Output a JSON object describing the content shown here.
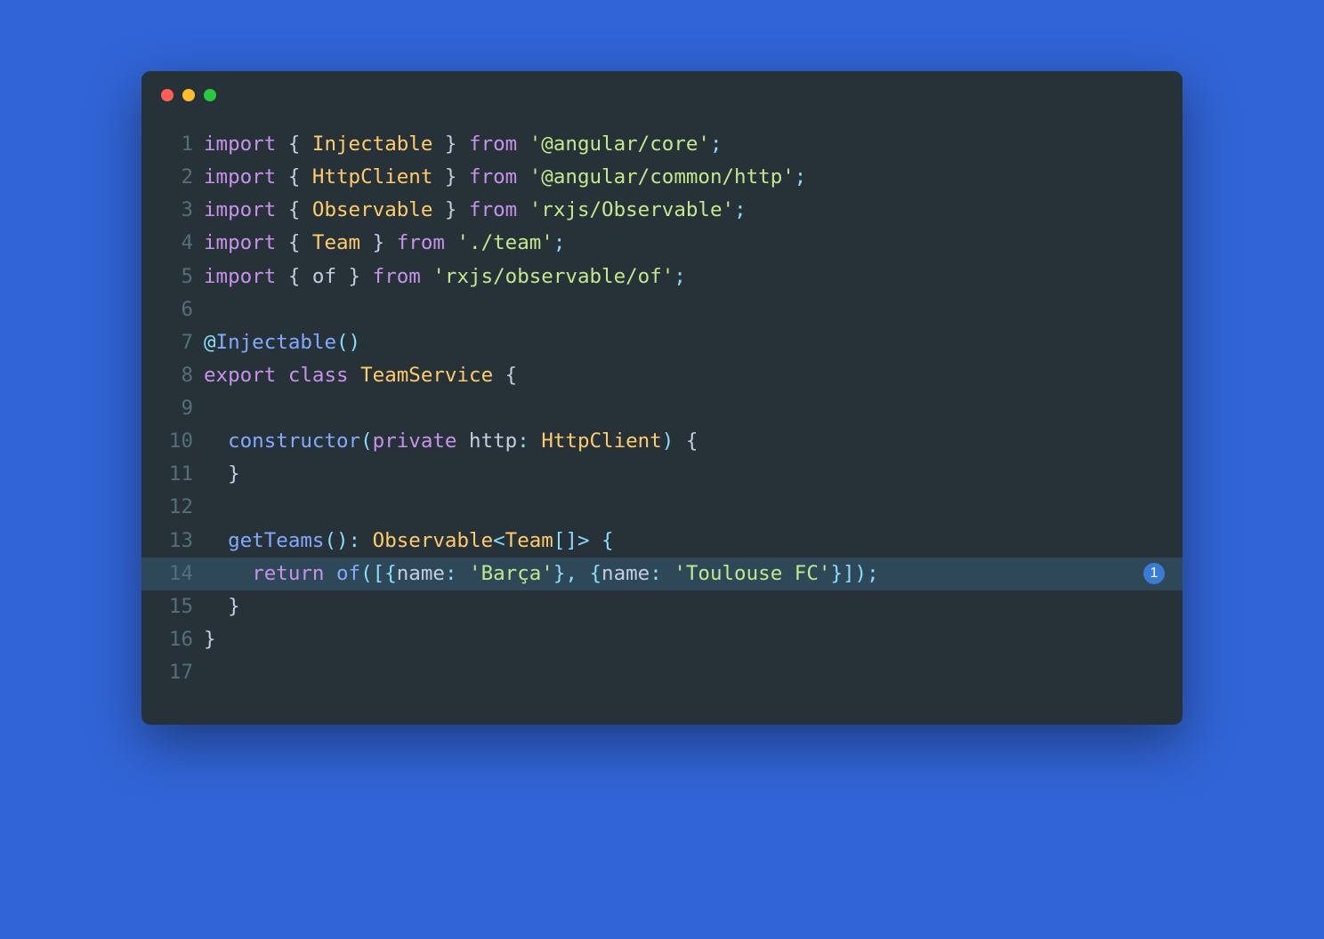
{
  "window": {
    "dots": [
      "red",
      "yellow",
      "green"
    ]
  },
  "code": {
    "highlighted_line": 14,
    "badge_line": 14,
    "badge_text": "1",
    "lines": [
      {
        "num": 1,
        "tokens": [
          {
            "t": "import",
            "c": "keyword"
          },
          {
            "t": " { ",
            "c": "plain"
          },
          {
            "t": "Injectable",
            "c": "type"
          },
          {
            "t": " } ",
            "c": "plain"
          },
          {
            "t": "from",
            "c": "keyword"
          },
          {
            "t": " ",
            "c": "plain"
          },
          {
            "t": "'@angular/core'",
            "c": "string"
          },
          {
            "t": ";",
            "c": "punct"
          }
        ]
      },
      {
        "num": 2,
        "tokens": [
          {
            "t": "import",
            "c": "keyword"
          },
          {
            "t": " { ",
            "c": "plain"
          },
          {
            "t": "HttpClient",
            "c": "type"
          },
          {
            "t": " } ",
            "c": "plain"
          },
          {
            "t": "from",
            "c": "keyword"
          },
          {
            "t": " ",
            "c": "plain"
          },
          {
            "t": "'@angular/common/http'",
            "c": "string"
          },
          {
            "t": ";",
            "c": "punct"
          }
        ]
      },
      {
        "num": 3,
        "tokens": [
          {
            "t": "import",
            "c": "keyword"
          },
          {
            "t": " { ",
            "c": "plain"
          },
          {
            "t": "Observable",
            "c": "type"
          },
          {
            "t": " } ",
            "c": "plain"
          },
          {
            "t": "from",
            "c": "keyword"
          },
          {
            "t": " ",
            "c": "plain"
          },
          {
            "t": "'rxjs/Observable'",
            "c": "string"
          },
          {
            "t": ";",
            "c": "punct"
          }
        ]
      },
      {
        "num": 4,
        "tokens": [
          {
            "t": "import",
            "c": "keyword"
          },
          {
            "t": " { ",
            "c": "plain"
          },
          {
            "t": "Team",
            "c": "type"
          },
          {
            "t": " } ",
            "c": "plain"
          },
          {
            "t": "from",
            "c": "keyword"
          },
          {
            "t": " ",
            "c": "plain"
          },
          {
            "t": "'./team'",
            "c": "string"
          },
          {
            "t": ";",
            "c": "punct"
          }
        ]
      },
      {
        "num": 5,
        "tokens": [
          {
            "t": "import",
            "c": "keyword"
          },
          {
            "t": " { ",
            "c": "plain"
          },
          {
            "t": "of",
            "c": "plain"
          },
          {
            "t": " } ",
            "c": "plain"
          },
          {
            "t": "from",
            "c": "keyword"
          },
          {
            "t": " ",
            "c": "plain"
          },
          {
            "t": "'rxjs/observable/of'",
            "c": "string"
          },
          {
            "t": ";",
            "c": "punct"
          }
        ]
      },
      {
        "num": 6,
        "tokens": []
      },
      {
        "num": 7,
        "tokens": [
          {
            "t": "@",
            "c": "punct"
          },
          {
            "t": "Injectable",
            "c": "deco"
          },
          {
            "t": "()",
            "c": "punct"
          }
        ]
      },
      {
        "num": 8,
        "tokens": [
          {
            "t": "export",
            "c": "keyword"
          },
          {
            "t": " ",
            "c": "plain"
          },
          {
            "t": "class",
            "c": "keyword"
          },
          {
            "t": " ",
            "c": "plain"
          },
          {
            "t": "TeamService",
            "c": "type"
          },
          {
            "t": " {",
            "c": "plain"
          }
        ]
      },
      {
        "num": 9,
        "tokens": []
      },
      {
        "num": 10,
        "tokens": [
          {
            "t": "  ",
            "c": "plain"
          },
          {
            "t": "constructor",
            "c": "func"
          },
          {
            "t": "(",
            "c": "punct"
          },
          {
            "t": "private",
            "c": "keyword"
          },
          {
            "t": " http",
            "c": "param"
          },
          {
            "t": ":",
            "c": "punct"
          },
          {
            "t": " ",
            "c": "plain"
          },
          {
            "t": "HttpClient",
            "c": "type"
          },
          {
            "t": ")",
            "c": "punct"
          },
          {
            "t": " {",
            "c": "plain"
          }
        ]
      },
      {
        "num": 11,
        "tokens": [
          {
            "t": "  }",
            "c": "plain"
          }
        ]
      },
      {
        "num": 12,
        "tokens": []
      },
      {
        "num": 13,
        "tokens": [
          {
            "t": "  ",
            "c": "plain"
          },
          {
            "t": "getTeams",
            "c": "func"
          },
          {
            "t": "():",
            "c": "punct"
          },
          {
            "t": " ",
            "c": "plain"
          },
          {
            "t": "Observable",
            "c": "type"
          },
          {
            "t": "<",
            "c": "punct"
          },
          {
            "t": "Team",
            "c": "type"
          },
          {
            "t": "[]> {",
            "c": "punct"
          }
        ]
      },
      {
        "num": 14,
        "tokens": [
          {
            "t": "    ",
            "c": "plain"
          },
          {
            "t": "return",
            "c": "keyword"
          },
          {
            "t": " ",
            "c": "plain"
          },
          {
            "t": "of",
            "c": "func"
          },
          {
            "t": "([{",
            "c": "punct"
          },
          {
            "t": "name",
            "c": "plain"
          },
          {
            "t": ":",
            "c": "punct"
          },
          {
            "t": " ",
            "c": "plain"
          },
          {
            "t": "'Barça'",
            "c": "string"
          },
          {
            "t": "}, {",
            "c": "punct"
          },
          {
            "t": "name",
            "c": "plain"
          },
          {
            "t": ":",
            "c": "punct"
          },
          {
            "t": " ",
            "c": "plain"
          },
          {
            "t": "'Toulouse FC'",
            "c": "string"
          },
          {
            "t": "}]);",
            "c": "punct"
          }
        ]
      },
      {
        "num": 15,
        "tokens": [
          {
            "t": "  }",
            "c": "plain"
          }
        ]
      },
      {
        "num": 16,
        "tokens": [
          {
            "t": "}",
            "c": "plain"
          }
        ]
      },
      {
        "num": 17,
        "tokens": []
      }
    ]
  }
}
